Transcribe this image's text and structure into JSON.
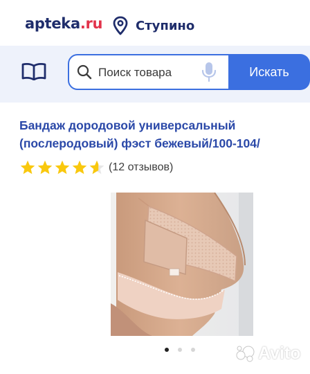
{
  "header": {
    "logo_main": "apteka",
    "logo_suffix": ".ru",
    "city": "Ступино",
    "location_icon": "map-pin-icon"
  },
  "search": {
    "catalog_icon": "open-book-icon",
    "placeholder": "Поиск товара",
    "mic_icon": "microphone-icon",
    "button_label": "Искать"
  },
  "product": {
    "title": "Бандаж дородовой универсальный (послеродовый) фэст бежевый/100-104/",
    "rating": 4.5,
    "rating_max": 5,
    "reviews": "(12 отзывов)",
    "image": "maternity-support-belt-photo"
  },
  "gallery": {
    "slides": 3,
    "active_index": 0
  },
  "watermark": {
    "text": "Avito"
  },
  "colors": {
    "brand_navy": "#1f2d6b",
    "brand_red": "#e2334b",
    "accent_blue": "#3b6fe0",
    "title_blue": "#2a48a8",
    "star_yellow": "#f9c80e",
    "search_bg": "#eef2fb"
  }
}
